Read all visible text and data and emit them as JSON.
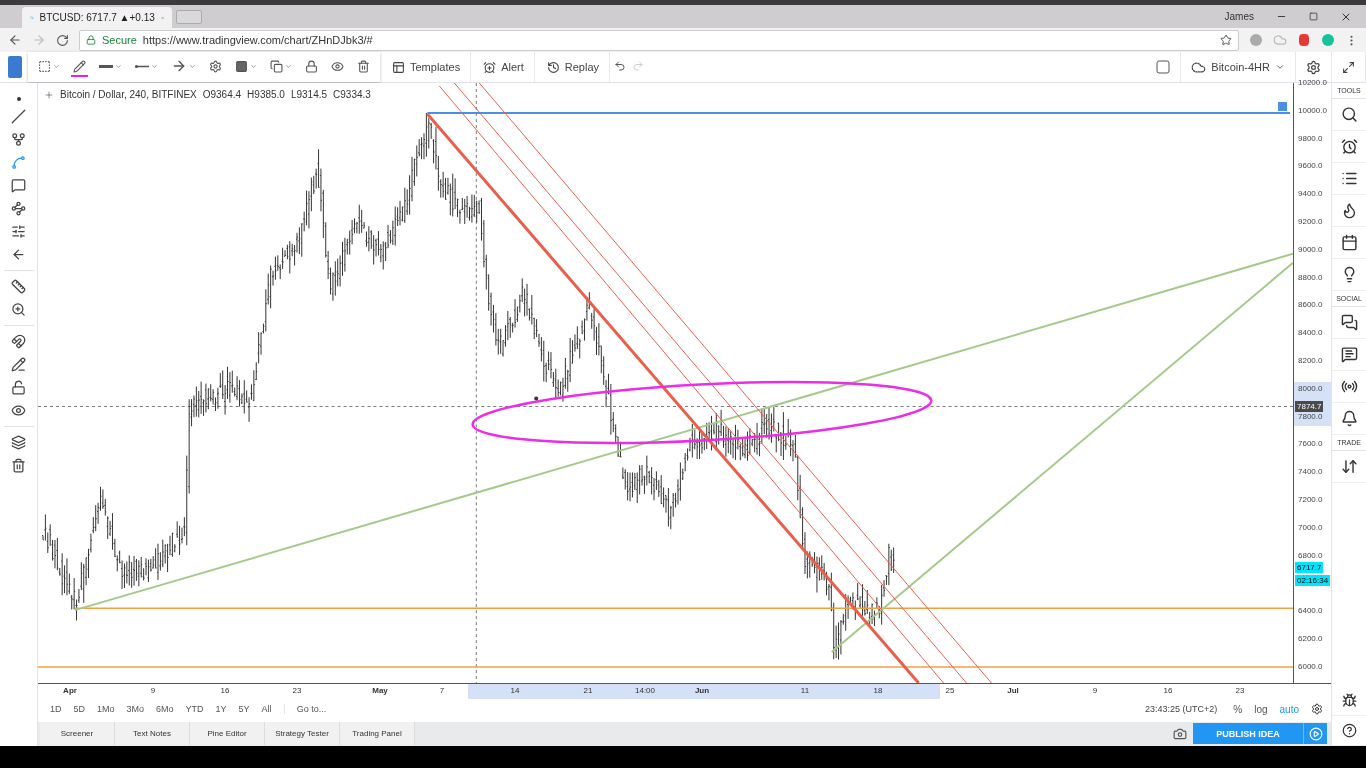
{
  "browser": {
    "tab": {
      "title": "BTCUSD: 6717.7 ▲+0.13"
    },
    "user": "James",
    "address": {
      "secure_label": "Secure",
      "url": "https://www.tradingview.com/chart/ZHnDJbk3/#"
    }
  },
  "toolbar": {
    "buttons": [
      {
        "label": "Templates",
        "kind": "templates"
      },
      {
        "label": "Alert",
        "kind": "alert"
      },
      {
        "label": "Replay",
        "kind": "replay"
      }
    ],
    "layout_name": "Bitcoin-4HR",
    "checkbox": {
      "checked": false
    }
  },
  "legend": {
    "symbol": "Bitcoin / Dollar, 240, BITFINEX",
    "open": "O9364.4",
    "high": "H9385.0",
    "low": "L9314.5",
    "close": "C9334.3"
  },
  "price_axis": {
    "ticks": [
      "10200.0",
      "10000.0",
      "9800.0",
      "9600.0",
      "9400.0",
      "9200.0",
      "9000.0",
      "8800.0",
      "8600.0",
      "8400.0",
      "8200.0",
      "8000.0",
      "7800.0",
      "7600.0",
      "7400.0",
      "7200.0",
      "7000.0",
      "6800.0",
      "6400.0",
      "6200.0",
      "6000.0"
    ],
    "crosshair_label": "7874.7",
    "last_price": "6717.7",
    "countdown": "02:16:34"
  },
  "time_axis": {
    "ticks": [
      {
        "label": "Apr",
        "kind": "month"
      },
      {
        "label": "9",
        "kind": "day"
      },
      {
        "label": "16",
        "kind": "day"
      },
      {
        "label": "23",
        "kind": "day"
      },
      {
        "label": "May",
        "kind": "month"
      },
      {
        "label": "7",
        "kind": "day"
      },
      {
        "label": "14",
        "kind": "day"
      },
      {
        "label": "21",
        "kind": "day"
      },
      {
        "label": "14:00",
        "kind": "day"
      },
      {
        "label": "Jun",
        "kind": "month"
      },
      {
        "label": "11",
        "kind": "day"
      },
      {
        "label": "18",
        "kind": "day"
      },
      {
        "label": "25",
        "kind": "day"
      },
      {
        "label": "Jul",
        "kind": "month"
      },
      {
        "label": "9",
        "kind": "day"
      },
      {
        "label": "16",
        "kind": "day"
      },
      {
        "label": "23",
        "kind": "day"
      }
    ]
  },
  "ranges": [
    "1D",
    "5D",
    "1Mo",
    "3Mo",
    "6Mo",
    "YTD",
    "1Y",
    "5Y",
    "All"
  ],
  "goto": "Go to...",
  "clock": "23:43:25 (UTC+2)",
  "scale_options": [
    {
      "label": "%",
      "selected": false
    },
    {
      "label": "log",
      "selected": false
    },
    {
      "label": "auto",
      "selected": true
    }
  ],
  "bottom_tabs": [
    "Screener",
    "Text Notes",
    "Pine Editor",
    "Strategy Tester",
    "Trading Panel"
  ],
  "publish": "PUBLISH IDEA",
  "sidebar": {
    "sections": [
      "TOOLS",
      "SOCIAL",
      "TRADE"
    ]
  }
}
